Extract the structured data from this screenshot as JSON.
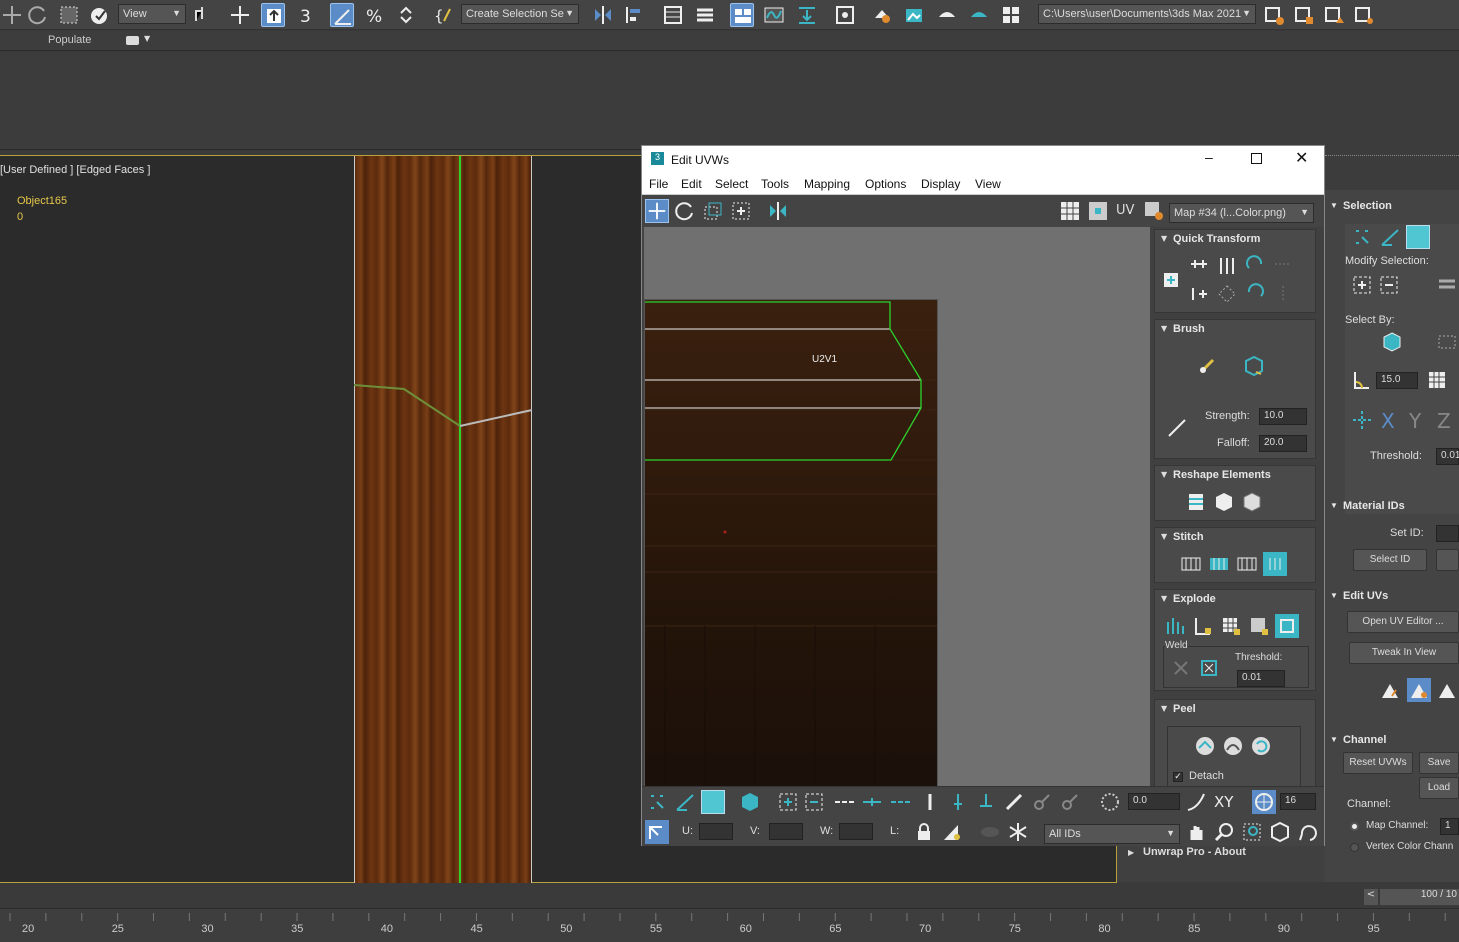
{
  "toolbar": {
    "view_dropdown": "View",
    "selection_set_dropdown": "Create Selection Se",
    "project_path": "C:\\Users\\user\\Documents\\3ds Max 2021"
  },
  "ribbon": {
    "populate_tab": "Populate"
  },
  "viewport": {
    "label": "[User Defined ] [Edged Faces ]",
    "object_name": "Object165",
    "object_value": "0"
  },
  "uvw_window": {
    "title": "Edit UVWs",
    "menu": [
      "File",
      "Edit",
      "Select",
      "Tools",
      "Mapping",
      "Options",
      "Display",
      "View"
    ],
    "uv_label": "UV",
    "map_dropdown": "Map #34 (l...Color.png)",
    "canvas_label": "U2V1",
    "panels": {
      "quick_transform": "Quick Transform",
      "brush": "Brush",
      "strength_label": "Strength:",
      "strength_value": "10.0",
      "falloff_label": "Falloff:",
      "falloff_value": "20.0",
      "reshape": "Reshape Elements",
      "stitch": "Stitch",
      "explode": "Explode",
      "weld": "Weld",
      "threshold_label": "Threshold:",
      "threshold_value": "0.01",
      "peel": "Peel",
      "detach": "Detach"
    },
    "bottom": {
      "angle_value": "0.0",
      "xy_label": "XY",
      "snap_value": "16",
      "u_label": "U:",
      "v_label": "V:",
      "w_label": "W:",
      "l_label": "L:",
      "ids_dropdown": "All IDs"
    }
  },
  "command_panel": {
    "selection": "Selection",
    "modify_selection": "Modify Selection:",
    "select_by": "Select By:",
    "angle_value": "15.0",
    "threshold_label": "Threshold:",
    "threshold_value": "0.01",
    "material_ids": "Material IDs",
    "set_id_label": "Set ID:",
    "select_id_button": "Select ID",
    "edit_uvs": "Edit UVs",
    "open_uv_editor": "Open UV Editor ...",
    "tweak_in_view": "Tweak In View",
    "channel": "Channel",
    "reset_uvws": "Reset UVWs",
    "save": "Save",
    "load": "Load",
    "channel_label": "Channel:",
    "map_channel_label": "Map Channel:",
    "map_channel_value": "1",
    "vertex_color_channel": "Vertex Color Chann",
    "unwrap_pro": "Unwrap Pro - About"
  },
  "timeline": {
    "frame_counter": "100 / 10",
    "ticks": [
      "20",
      "25",
      "30",
      "35",
      "40",
      "45",
      "50",
      "55",
      "60",
      "65",
      "70",
      "75",
      "80",
      "85",
      "90",
      "95"
    ]
  },
  "colors": {
    "accent_blue": "#5b8cc7",
    "viewport_border": "#b8a23c",
    "uv_green": "#2bd32b",
    "teal_icon": "#3bb6c4"
  }
}
